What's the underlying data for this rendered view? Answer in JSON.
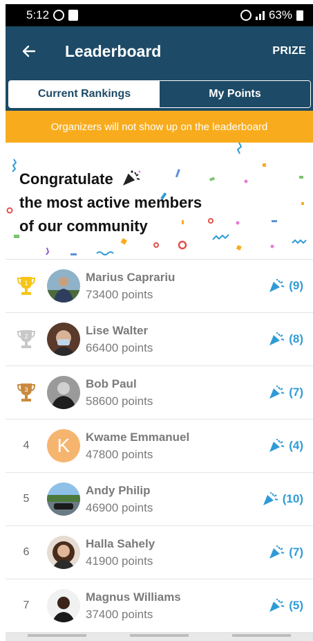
{
  "status_bar": {
    "time": "5:12",
    "battery": "63%"
  },
  "header": {
    "title": "Leaderboard",
    "prize_label": "PRIZE"
  },
  "tabs": [
    {
      "label": "Current Rankings",
      "active": true
    },
    {
      "label": "My Points",
      "active": false
    }
  ],
  "notice": "Organizers will not show up on the leaderboard",
  "banner": {
    "line1": "Congratulate",
    "line2": "the most active members",
    "line3": "of our community"
  },
  "leaderboard": [
    {
      "rank": "1",
      "trophy": "gold",
      "name": "Marius Caprariu",
      "points": "73400 points",
      "congrats": "(9)",
      "avatar": "photo"
    },
    {
      "rank": "2",
      "trophy": "silver",
      "name": "Lise Walter",
      "points": "66400 points",
      "congrats": "(8)",
      "avatar": "photo"
    },
    {
      "rank": "3",
      "trophy": "bronze",
      "name": "Bob Paul",
      "points": "58600 points",
      "congrats": "(7)",
      "avatar": "photo"
    },
    {
      "rank": "4",
      "trophy": "",
      "name": "Kwame Emmanuel",
      "points": "47800 points",
      "congrats": "(4)",
      "avatar": "K"
    },
    {
      "rank": "5",
      "trophy": "",
      "name": "Andy Philip",
      "points": "46900 points",
      "congrats": "(10)",
      "avatar": "photo"
    },
    {
      "rank": "6",
      "trophy": "",
      "name": "Halla Sahely",
      "points": "41900 points",
      "congrats": "(7)",
      "avatar": "photo"
    },
    {
      "rank": "7",
      "trophy": "",
      "name": "Magnus Williams",
      "points": "37400 points",
      "congrats": "(5)",
      "avatar": "photo"
    }
  ],
  "colors": {
    "app_bar": "#1d4a66",
    "notice": "#f8ac1d",
    "accent": "#2e9bd6",
    "gold": "#f5c518",
    "silver": "#c8c8c8",
    "bronze": "#c98a3e",
    "avatar_k": "#f6b56f"
  },
  "icons": {
    "back": "arrow-left-icon",
    "congrats": "party-popper-icon",
    "trophy": "trophy-icon"
  }
}
